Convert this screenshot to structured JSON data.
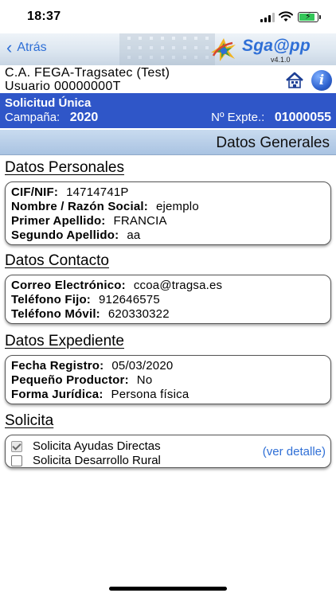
{
  "status_bar": {
    "time": "18:37"
  },
  "nav": {
    "back_label": "Atrás",
    "logo_text": "Sga@pp",
    "version": "v4.1.0"
  },
  "user": {
    "ca": "C.A.  FEGA-Tragsatec (Test)",
    "usuario": "Usuario  00000000T"
  },
  "band": {
    "title": "Solicitud Única",
    "campaign_label": "Campaña:",
    "campaign_value": "2020",
    "expte_label": "Nº Expte.:",
    "expte_value": "01000055"
  },
  "section_header": "Datos Generales",
  "datos_personales": {
    "title": "Datos Personales",
    "rows": [
      {
        "label": "CIF/NIF:",
        "value": "14714741P"
      },
      {
        "label": "Nombre / Razón Social:",
        "value": "ejemplo"
      },
      {
        "label": "Primer Apellido:",
        "value": "FRANCIA"
      },
      {
        "label": "Segundo Apellido:",
        "value": "aa"
      }
    ]
  },
  "datos_contacto": {
    "title": "Datos Contacto",
    "rows": [
      {
        "label": "Correo Electrónico:",
        "value": "ccoa@tragsa.es"
      },
      {
        "label": "Teléfono Fijo:",
        "value": "912646575"
      },
      {
        "label": "Teléfono Móvil:",
        "value": "620330322"
      }
    ]
  },
  "datos_expediente": {
    "title": "Datos Expediente",
    "rows": [
      {
        "label": "Fecha Registro:",
        "value": "05/03/2020"
      },
      {
        "label": "Pequeño Productor:",
        "value": "No"
      },
      {
        "label": "Forma Jurídica:",
        "value": "Persona física"
      }
    ]
  },
  "solicita": {
    "title": "Solicita",
    "items": [
      {
        "label": "Solicita Ayudas Directas",
        "checked": true
      },
      {
        "label": "Solicita Desarrollo Rural",
        "checked": false
      }
    ],
    "detail_link": "(ver detalle)"
  },
  "colors": {
    "accent": "#2f6fd6",
    "band": "#2f56c8",
    "header_gradient_top": "#c9dbef"
  }
}
